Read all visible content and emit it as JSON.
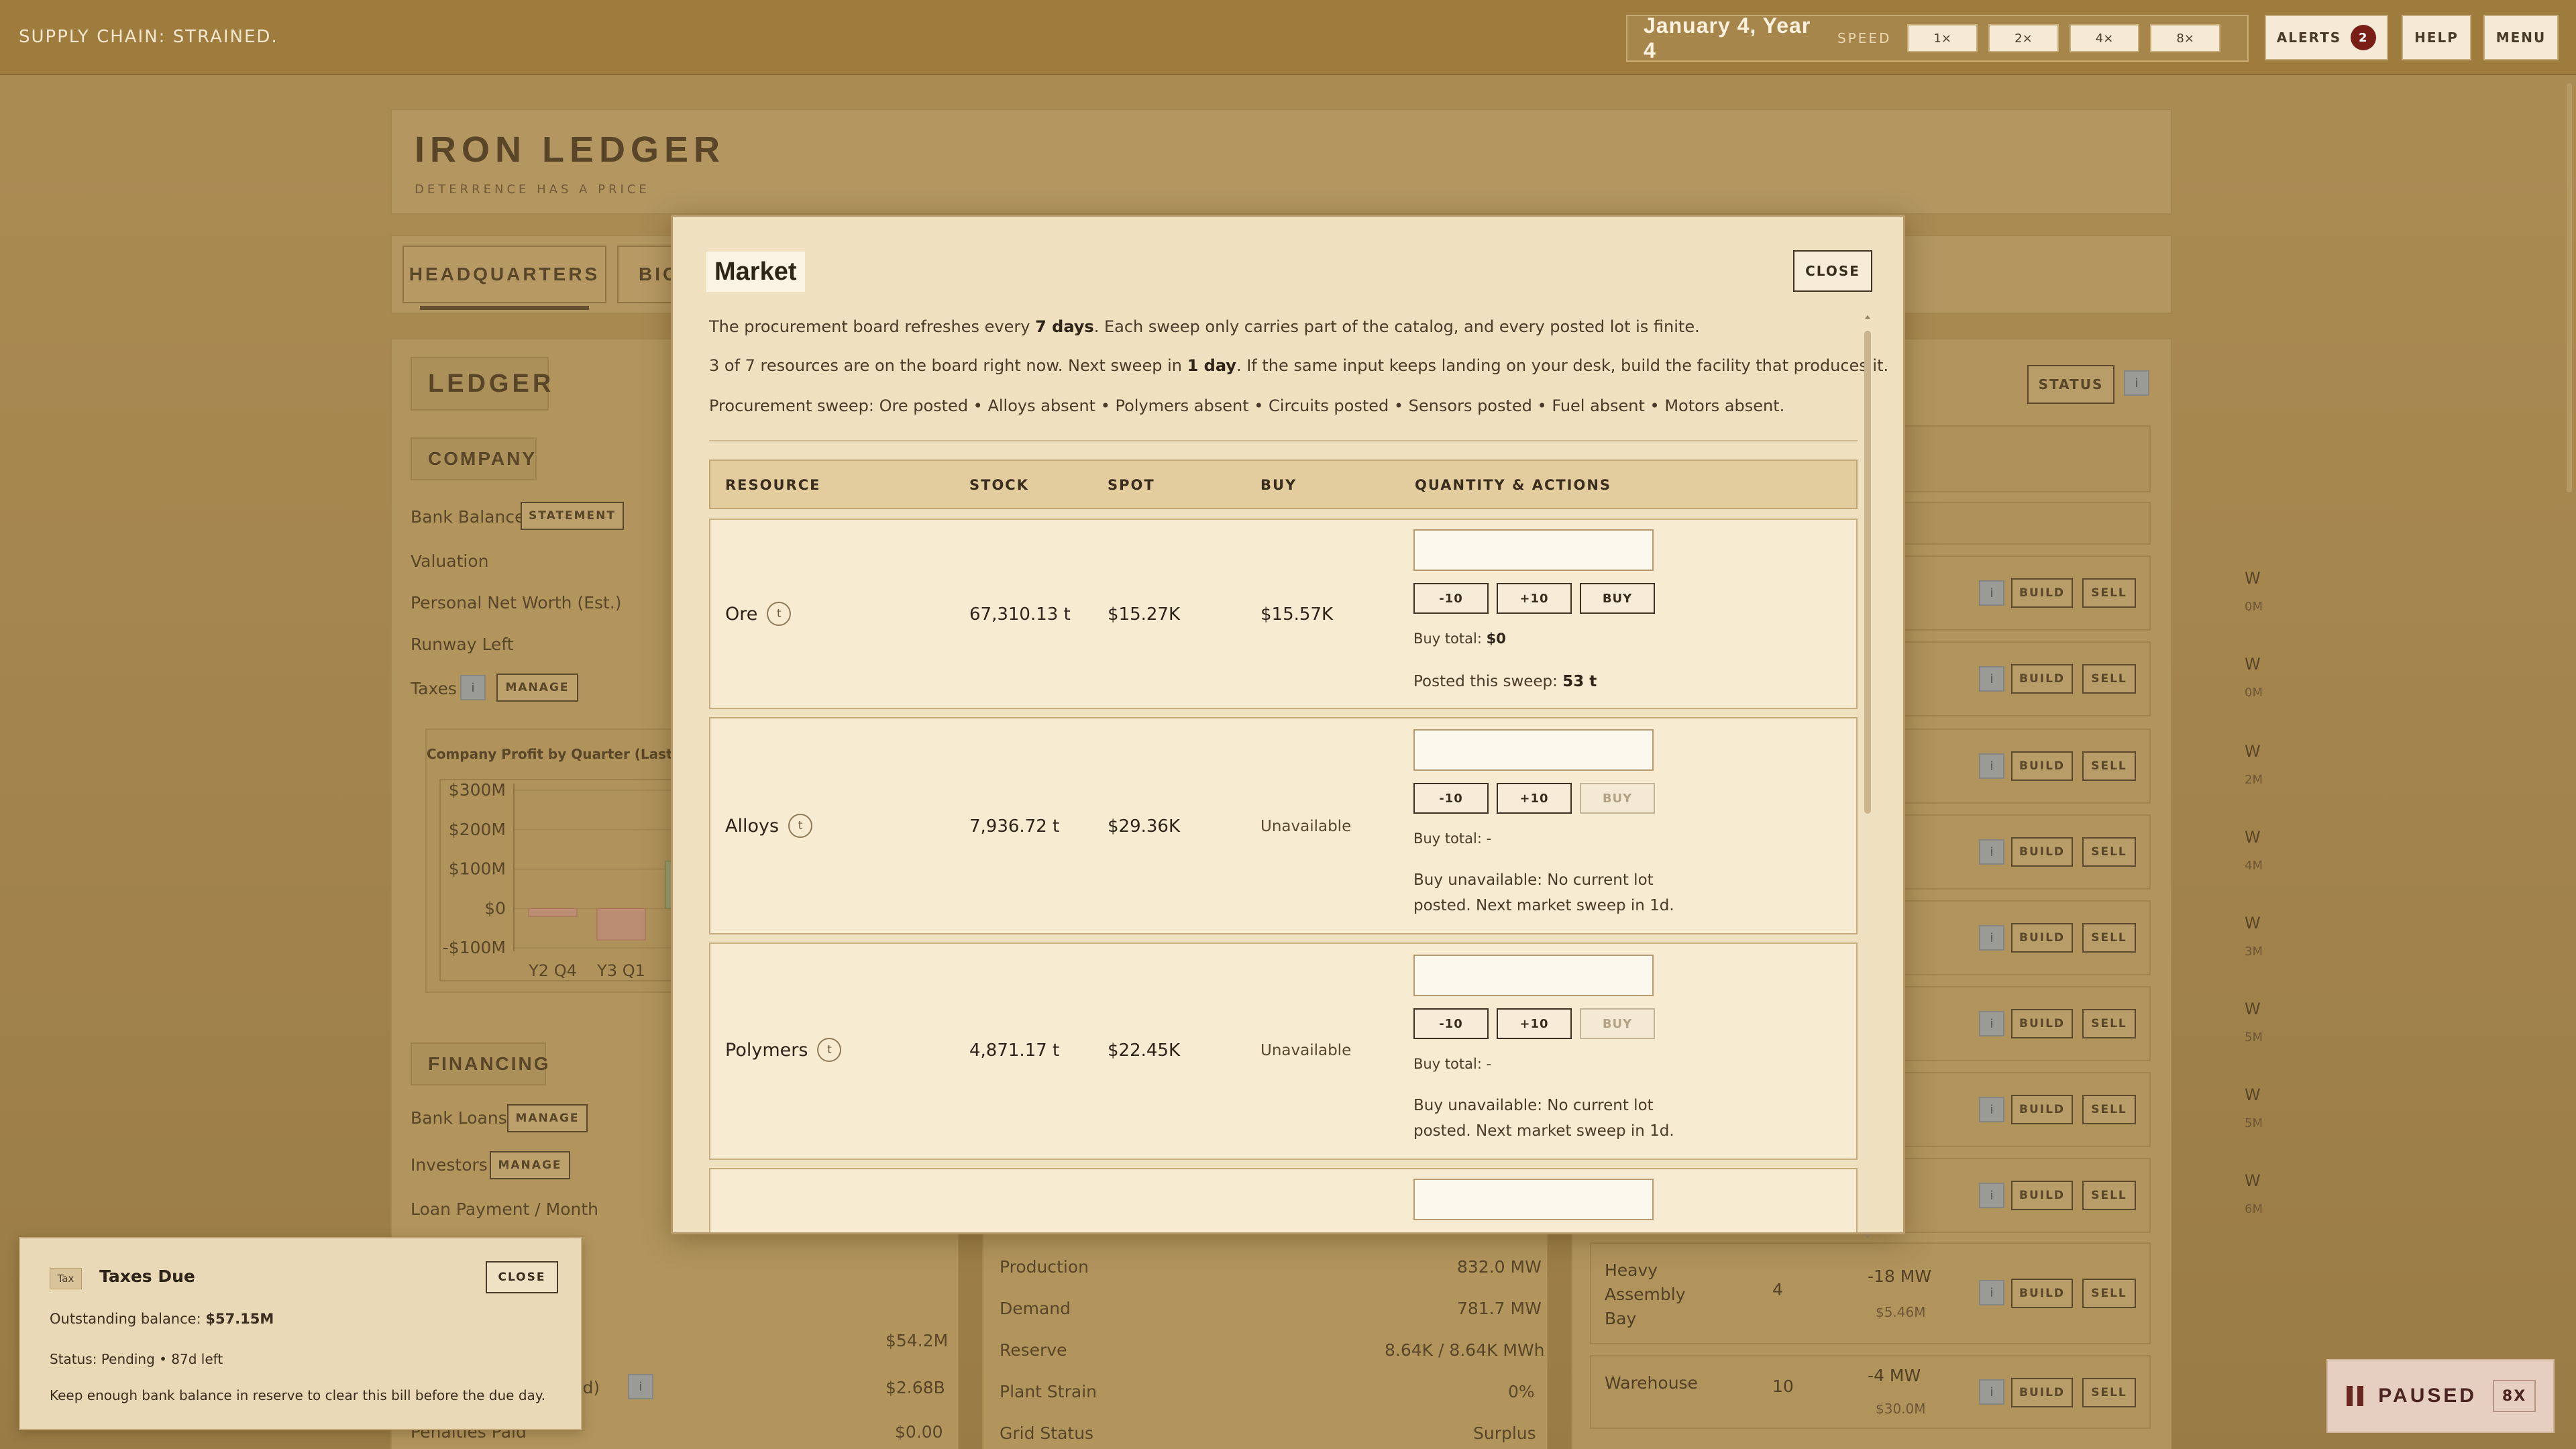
{
  "topbar": {
    "supply_status": "SUPPLY CHAIN: STRAINED.",
    "date": "January 4, Year 4",
    "speed_label": "SPEED",
    "speeds": [
      "1×",
      "2×",
      "4×",
      "8×"
    ],
    "alerts_label": "ALERTS",
    "alerts_count": "2",
    "help_label": "HELP",
    "menu_label": "MENU"
  },
  "company": {
    "title": "IRON LEDGER",
    "tagline": "DETERRENCE HAS A PRICE"
  },
  "tabs": [
    "HEADQUARTERS",
    "BIO"
  ],
  "ledger": {
    "title": "LEDGER",
    "company_section": "COMPANY",
    "rows": [
      "Bank Balance",
      "Valuation",
      "Personal Net Worth (Est.)",
      "Runway Left",
      "Taxes"
    ],
    "statement_label": "STATEMENT",
    "manage_label": "MANAGE",
    "chart_title": "Company Profit by Quarter (Last 6 Qu",
    "financing_section": "FINANCING",
    "financing_rows": [
      "Bank Loans",
      "Investors",
      "Loan Payment / Month"
    ],
    "values": [
      "$54.2M",
      "$2.68B",
      "$0.00"
    ],
    "ered_row": "ered)",
    "penalties": "Penalties Paid"
  },
  "chart_data": {
    "type": "bar",
    "title": "Company Profit by Quarter (Last 6 Qu",
    "categories": [
      "Y2 Q4",
      "Y3 Q1",
      "Y3"
    ],
    "values": [
      -20,
      -80,
      120
    ],
    "yticks": [
      "$300M",
      "$200M",
      "$100M",
      "$0",
      "-$100M"
    ],
    "ylim": [
      -100,
      300
    ],
    "colors": {
      "negative": "#d09a8e",
      "positive": "#9fb58a"
    }
  },
  "power": {
    "rows": [
      {
        "label": "Production",
        "value": "832.0 MW"
      },
      {
        "label": "Demand",
        "value": "781.7 MW"
      },
      {
        "label": "Reserve",
        "value": "8.64K / 8.64K MWh"
      },
      {
        "label": "Plant Strain",
        "value": "0%"
      },
      {
        "label": "Grid Status",
        "value": "Surplus"
      }
    ]
  },
  "facilities": {
    "status_label": "STATUS",
    "header_fragment": "t /\nST",
    "build_label": "BUILD",
    "sell_label": "SELL",
    "info_label": "i",
    "mw_rows": [
      {
        "mw": "W",
        "sub": "0M"
      },
      {
        "mw": "W",
        "sub": "0M"
      },
      {
        "mw": "W",
        "sub": "2M"
      },
      {
        "mw": "W",
        "sub": "4M"
      },
      {
        "mw": "W",
        "sub": "3M"
      },
      {
        "mw": "W",
        "sub": "5M"
      },
      {
        "mw": "W",
        "sub": "5M"
      },
      {
        "mw": "W",
        "sub": "6M"
      }
    ],
    "named": [
      {
        "name": "Heavy Assembly Bay",
        "count": "4",
        "mw": "-18 MW",
        "cost": "$5.46M"
      },
      {
        "name": "Warehouse",
        "count": "10",
        "mw": "-4 MW",
        "cost": "$30.0M"
      }
    ]
  },
  "market": {
    "title": "Market",
    "close_label": "CLOSE",
    "line1_a": "The procurement board refreshes every ",
    "line1_b": "7 days",
    "line1_c": ". Each sweep only carries part of the catalog, and every posted lot is finite.",
    "line2_a": "3 of 7 resources are on the board right now. Next sweep in ",
    "line2_b": "1 day",
    "line2_c": ". If the same input keeps landing on your desk, build the facility that produces it.",
    "line3": "Procurement sweep: Ore posted • Alloys absent • Polymers absent • Circuits posted • Sensors posted • Fuel absent • Motors absent.",
    "headers": [
      "RESOURCE",
      "STOCK",
      "SPOT",
      "BUY",
      "QUANTITY & ACTIONS"
    ],
    "minus_label": "-10",
    "plus_label": "+10",
    "buy_label": "BUY",
    "buy_total_label": "Buy total: ",
    "info_glyph": "t",
    "rows": [
      {
        "name": "Ore",
        "stock": "67,310.13 t",
        "spot": "$15.27K",
        "buy": "$15.57K",
        "buy_total": "$0",
        "posted_label": "Posted this sweep: ",
        "posted": "53 t"
      },
      {
        "name": "Alloys",
        "stock": "7,936.72 t",
        "spot": "$29.36K",
        "buy": "Unavailable",
        "buy_total": "-",
        "unavail_1": "Buy unavailable: No current lot",
        "unavail_2": "posted. Next market sweep in 1d."
      },
      {
        "name": "Polymers",
        "stock": "4,871.17 t",
        "spot": "$22.45K",
        "buy": "Unavailable",
        "buy_total": "-",
        "unavail_1": "Buy unavailable: No current lot",
        "unavail_2": "posted. Next market sweep in 1d."
      }
    ]
  },
  "toast": {
    "tag": "Tax",
    "title": "Taxes Due",
    "close_label": "CLOSE",
    "balance_label": "Outstanding balance: ",
    "balance": "$57.15M",
    "status": "Status: Pending • 87d left",
    "advice": "Keep enough bank balance in reserve to clear this bill before the due day."
  },
  "paused": {
    "label": "PAUSED",
    "speed": "8X"
  }
}
